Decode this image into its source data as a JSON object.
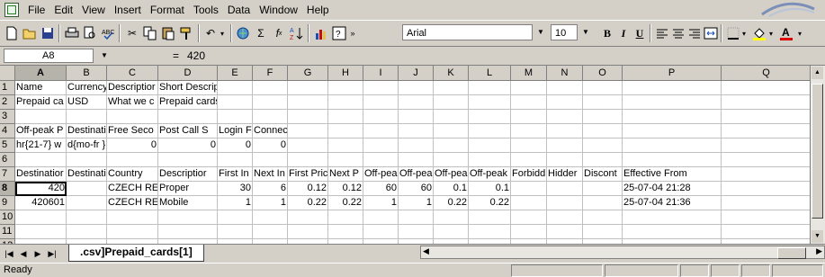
{
  "menu": {
    "items": [
      "File",
      "Edit",
      "View",
      "Insert",
      "Format",
      "Tools",
      "Data",
      "Window",
      "Help"
    ],
    "underline": [
      "F",
      "E",
      "V",
      "I",
      "o",
      "T",
      "D",
      "W",
      "H"
    ]
  },
  "toolbar": {
    "font_name": "Arial",
    "font_size": "10"
  },
  "formula_bar": {
    "name_box": "A8",
    "equals": "=",
    "value": "420"
  },
  "columns": [
    "A",
    "B",
    "C",
    "D",
    "E",
    "F",
    "G",
    "H",
    "I",
    "J",
    "K",
    "L",
    "M",
    "N",
    "O",
    "P",
    "Q"
  ],
  "rows": [
    [
      "Name",
      "Currency",
      "Descriptior",
      "Short Description",
      "",
      "",
      "",
      "",
      "",
      "",
      "",
      "",
      "",
      "",
      "",
      "",
      ""
    ],
    [
      "Prepaid ca",
      "USD",
      "What we c",
      "Prepaid cards",
      "",
      "",
      "",
      "",
      "",
      "",
      "",
      "",
      "",
      "",
      "",
      "",
      ""
    ],
    [
      "",
      "",
      "",
      "",
      "",
      "",
      "",
      "",
      "",
      "",
      "",
      "",
      "",
      "",
      "",
      "",
      ""
    ],
    [
      "Off-peak P",
      "Destinatic",
      "Free Seco",
      "Post Call S",
      "Login F",
      "Connect Fee",
      "",
      "",
      "",
      "",
      "",
      "",
      "",
      "",
      "",
      "",
      ""
    ],
    [
      "hr{21-7} w",
      "d{mo-fr }, v",
      "0",
      "0",
      "0",
      "0",
      "",
      "",
      "",
      "",
      "",
      "",
      "",
      "",
      "",
      "",
      ""
    ],
    [
      "",
      "",
      "",
      "",
      "",
      "",
      "",
      "",
      "",
      "",
      "",
      "",
      "",
      "",
      "",
      "",
      ""
    ],
    [
      "Destinatior",
      "Destinatic",
      "Country",
      "Descriptior",
      "First In",
      "Next In",
      "First Pric",
      "Next P",
      "Off-peak",
      "Off-peak",
      "Off-peak",
      "Off-peak",
      "Forbidd",
      "Hidder",
      "Discont",
      "Effective From",
      ""
    ],
    [
      "420",
      "",
      "CZECH RE",
      "Proper",
      "30",
      "6",
      "0.12",
      "0.12",
      "60",
      "60",
      "0.1",
      "0.1",
      "",
      "",
      "",
      "25-07-04 21:28",
      ""
    ],
    [
      "420601",
      "",
      "CZECH RE",
      "Mobile",
      "1",
      "1",
      "0.22",
      "0.22",
      "1",
      "1",
      "0.22",
      "0.22",
      "",
      "",
      "",
      "25-07-04 21:36",
      ""
    ],
    [
      "",
      "",
      "",
      "",
      "",
      "",
      "",
      "",
      "",
      "",
      "",
      "",
      "",
      "",
      "",
      "",
      ""
    ],
    [
      "",
      "",
      "",
      "",
      "",
      "",
      "",
      "",
      "",
      "",
      "",
      "",
      "",
      "",
      "",
      "",
      ""
    ],
    [
      "",
      "",
      "",
      "",
      "",
      "",
      "",
      "",
      "",
      "",
      "",
      "",
      "",
      "",
      "",
      "",
      ""
    ]
  ],
  "row_numbers": [
    "1",
    "2",
    "3",
    "4",
    "5",
    "6",
    "7",
    "8",
    "9",
    "10",
    "11",
    "12"
  ],
  "sheet_tab": ".csv]Prepaid_cards[1]",
  "status": "Ready",
  "icons": [
    "new-icon",
    "open-icon",
    "save-icon",
    "print-icon",
    "print-preview-icon",
    "spelling-icon",
    "cut-icon",
    "copy-icon",
    "paste-icon",
    "format-painter-icon",
    "undo-icon",
    "hyperlink-icon",
    "autosum-icon",
    "function-icon",
    "sort-ascending-icon",
    "chart-wizard-icon",
    "help-icon",
    "bold-icon",
    "italic-icon",
    "underline-icon",
    "align-left-icon",
    "center-icon",
    "align-right-icon",
    "merge-icon",
    "borders-icon",
    "fill-color-icon",
    "font-color-icon"
  ]
}
